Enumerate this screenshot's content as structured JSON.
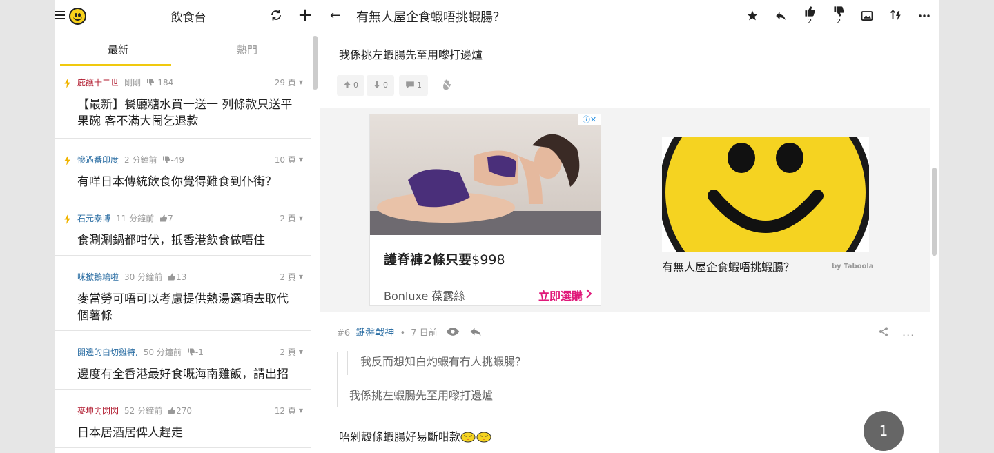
{
  "left_panel": {
    "channel_title": "飲食台",
    "tabs": [
      {
        "label": "最新",
        "active": true
      },
      {
        "label": "熱門",
        "active": false
      }
    ],
    "topics": [
      {
        "hot": true,
        "author": "庇護十二世",
        "author_color": "red",
        "time": "剛剛",
        "score_icon": "thumb-down-icon",
        "score": "-184",
        "pages": "29 頁",
        "title": "【最新】餐廳糖水買一送一 列條款只送平果碗 客不滿大鬧乞退款"
      },
      {
        "hot": true,
        "author": "慘過番印度",
        "author_color": "blue",
        "time": "2 分鐘前",
        "score_icon": "thumb-down-icon",
        "score": "-49",
        "pages": "10 頁",
        "title": "有咩日本傳統飲食你覺得難食到仆街？"
      },
      {
        "hot": true,
        "author": "石元泰博",
        "author_color": "blue",
        "time": "11 分鐘前",
        "score_icon": "thumb-up-icon",
        "score": "7",
        "pages": "2 頁",
        "title": "食涮涮鍋都咁伏，抵香港飲食做唔住"
      },
      {
        "hot": false,
        "author": "咪撳鵝鳩啦",
        "author_color": "blue",
        "time": "30 分鐘前",
        "score_icon": "thumb-up-icon",
        "score": "13",
        "pages": "2 頁",
        "title": "麥當勞可唔可以考慮提供熱湯選項去取代個薯條"
      },
      {
        "hot": false,
        "author": "開邊的白切雞特,",
        "author_color": "blue",
        "time": "50 分鐘前",
        "score_icon": "thumb-down-icon",
        "score": "-1",
        "pages": "2 頁",
        "title": "邊度有全香港最好食嘅海南雞飯，請出招"
      },
      {
        "hot": false,
        "author": "麥坤閃閃閃",
        "author_color": "red",
        "time": "52 分鐘前",
        "score_icon": "thumb-up-icon",
        "score": "270",
        "pages": "12 頁",
        "title": "日本居酒居俾人趕走"
      }
    ]
  },
  "right_panel": {
    "thread_title": "有無人屋企食蝦唔挑蝦腸？",
    "header_actions": {
      "like_count": "2",
      "dislike_count": "2"
    },
    "reply_top": {
      "text": "我係挑左蝦腸先至用嚟打邊爐",
      "upvotes": "0",
      "downvotes": "0",
      "comments": "1"
    },
    "ad": {
      "headline_bold": "護脊褲2條只要",
      "headline_price": "$998",
      "brand": "Bonluxe 葆露絲",
      "cta": "立即選購",
      "close_label": "ⓘ✕"
    },
    "recommendation": {
      "title": "有無人屋企食蝦唔挑蝦腸？",
      "source": "by Taboola"
    },
    "post6": {
      "number": "#6",
      "author": "鍵盤戰神",
      "time": "7 日前",
      "quote_inner": "我反而想知白灼蝦有冇人挑蝦腸？",
      "quote_outer": "我係挑左蝦腸先至用嚟打邊爐",
      "body": "唔剁殼條蝦腸好易斷咁款"
    },
    "page_number": "1"
  },
  "colors": {
    "accent_yellow": "#f0c90e",
    "author_red": "#b11a2e",
    "author_blue": "#2d6fa4",
    "cta_pink": "#e0197a"
  }
}
